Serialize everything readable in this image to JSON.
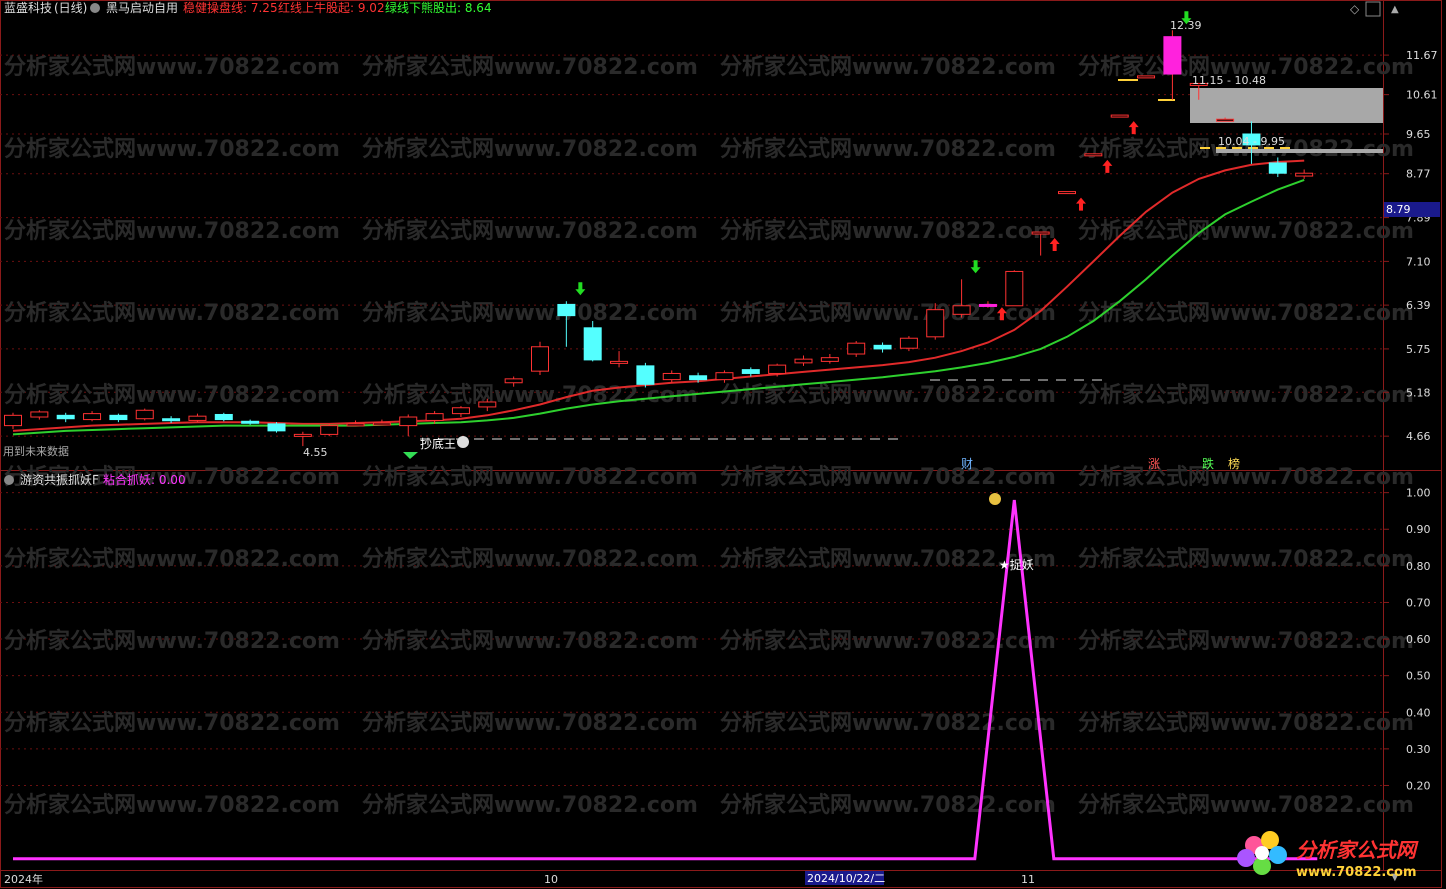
{
  "header": {
    "stock_name": "蓝盛科技",
    "period": "(日线)",
    "indicator_name": "黑马启动自用",
    "lines": [
      {
        "label": "稳健操盘线",
        "value": "7.25",
        "color": "#ff3333"
      },
      {
        "label": "红线上牛股起",
        "value": "9.02",
        "color": "#ff3333"
      },
      {
        "label": "绿线下熊股出",
        "value": "8.64",
        "color": "#33ff33"
      }
    ]
  },
  "window_controls": {
    "diamond_icon": "◇",
    "scroll_up_icon": "▲",
    "scroll_down_icon": "▼"
  },
  "watermark": "分析家公式网www.70822.com",
  "note_future_data": "用到未来数据",
  "markers": {
    "low_label": "4.55",
    "high_label": "12.39",
    "zone1_label": "11.15 - 10.48",
    "zone2_label": "10.04 - 9.95",
    "current_price": "8.79",
    "signal_text": "抄底王",
    "star_label": "★捉妖",
    "bottom_tags": [
      {
        "text": "财",
        "color": "#6fb4ff"
      },
      {
        "text": "涨",
        "color": "#ff5555"
      },
      {
        "text": "跌",
        "color": "#55ff55"
      },
      {
        "text": "榜",
        "color": "#ffdd55"
      }
    ]
  },
  "sub_header": {
    "indicator_name": "游资共振抓妖F",
    "line_label": "粘合抓妖",
    "line_value": "0.00",
    "line_color": "#ff33ff"
  },
  "x_axis": {
    "labels": [
      "2024年",
      "10",
      "11"
    ],
    "highlight_label": "2024/10/22/二"
  },
  "brand": {
    "name": "分析家公式网",
    "url": "www.70822.com"
  },
  "chart_data": [
    {
      "type": "candlestick",
      "y_ticks": [
        11.67,
        10.61,
        9.65,
        8.77,
        7.89,
        7.1,
        6.39,
        5.75,
        5.18,
        4.66
      ],
      "ylim": [
        4.4,
        12.7
      ],
      "scale": "log",
      "candles": [
        {
          "o": 4.78,
          "c": 4.9,
          "h": 4.93,
          "l": 4.74
        },
        {
          "o": 4.88,
          "c": 4.94,
          "h": 4.96,
          "l": 4.85
        },
        {
          "o": 4.9,
          "c": 4.86,
          "h": 4.93,
          "l": 4.82
        },
        {
          "o": 4.85,
          "c": 4.92,
          "h": 4.95,
          "l": 4.83
        },
        {
          "o": 4.9,
          "c": 4.85,
          "h": 4.92,
          "l": 4.82
        },
        {
          "o": 4.86,
          "c": 4.96,
          "h": 4.98,
          "l": 4.84
        },
        {
          "o": 4.86,
          "c": 4.84,
          "h": 4.89,
          "l": 4.81
        },
        {
          "o": 4.84,
          "c": 4.89,
          "h": 4.92,
          "l": 4.82
        },
        {
          "o": 4.91,
          "c": 4.85,
          "h": 4.93,
          "l": 4.83
        },
        {
          "o": 4.83,
          "c": 4.81,
          "h": 4.85,
          "l": 4.79
        },
        {
          "o": 4.8,
          "c": 4.72,
          "h": 4.82,
          "l": 4.7
        },
        {
          "o": 4.68,
          "c": 4.68,
          "h": 4.71,
          "l": 4.55
        },
        {
          "o": 4.68,
          "c": 4.78,
          "h": 4.8,
          "l": 4.66
        },
        {
          "o": 4.8,
          "c": 4.8,
          "h": 4.84,
          "l": 4.78
        },
        {
          "o": 4.81,
          "c": 4.81,
          "h": 4.85,
          "l": 4.79
        },
        {
          "o": 4.78,
          "c": 4.88,
          "h": 4.91,
          "l": 4.66
        },
        {
          "o": 4.84,
          "c": 4.92,
          "h": 4.95,
          "l": 4.8
        },
        {
          "o": 4.92,
          "c": 4.99,
          "h": 5.01,
          "l": 4.88
        },
        {
          "o": 5.0,
          "c": 5.06,
          "h": 5.1,
          "l": 4.95
        },
        {
          "o": 5.3,
          "c": 5.35,
          "h": 5.38,
          "l": 5.25
        },
        {
          "o": 5.45,
          "c": 5.78,
          "h": 5.85,
          "l": 5.4
        },
        {
          "o": 6.4,
          "c": 6.23,
          "h": 6.45,
          "l": 5.78
        },
        {
          "o": 6.05,
          "c": 5.6,
          "h": 6.15,
          "l": 5.58
        },
        {
          "o": 5.58,
          "c": 5.58,
          "h": 5.72,
          "l": 5.5
        },
        {
          "o": 5.52,
          "c": 5.28,
          "h": 5.56,
          "l": 5.24
        },
        {
          "o": 5.34,
          "c": 5.42,
          "h": 5.46,
          "l": 5.3
        },
        {
          "o": 5.39,
          "c": 5.34,
          "h": 5.43,
          "l": 5.3
        },
        {
          "o": 5.34,
          "c": 5.43,
          "h": 5.46,
          "l": 5.3
        },
        {
          "o": 5.47,
          "c": 5.42,
          "h": 5.5,
          "l": 5.38
        },
        {
          "o": 5.42,
          "c": 5.53,
          "h": 5.55,
          "l": 5.38
        },
        {
          "o": 5.56,
          "c": 5.61,
          "h": 5.66,
          "l": 5.52
        },
        {
          "o": 5.58,
          "c": 5.63,
          "h": 5.68,
          "l": 5.55
        },
        {
          "o": 5.68,
          "c": 5.83,
          "h": 5.86,
          "l": 5.64
        },
        {
          "o": 5.8,
          "c": 5.75,
          "h": 5.84,
          "l": 5.7
        },
        {
          "o": 5.76,
          "c": 5.9,
          "h": 5.93,
          "l": 5.72
        },
        {
          "o": 5.92,
          "c": 6.32,
          "h": 6.42,
          "l": 5.88
        },
        {
          "o": 6.25,
          "c": 6.38,
          "h": 6.8,
          "l": 6.2
        },
        {
          "o": 6.38,
          "c": 6.4,
          "h": 6.45,
          "l": 6.35
        },
        {
          "o": 6.38,
          "c": 6.93,
          "h": 6.95,
          "l": 6.38
        },
        {
          "o": 7.6,
          "c": 7.62,
          "h": 7.62,
          "l": 7.2
        },
        {
          "o": 8.4,
          "c": 8.4,
          "h": 8.4,
          "l": 8.4
        },
        {
          "o": 9.2,
          "c": 9.2,
          "h": 9.2,
          "l": 9.2
        },
        {
          "o": 10.1,
          "c": 10.1,
          "h": 10.1,
          "l": 10.1
        },
        {
          "o": 11.1,
          "c": 11.1,
          "h": 11.1,
          "l": 11.1
        },
        {
          "o": 11.15,
          "c": 12.2,
          "h": 12.39,
          "l": 10.48
        },
        {
          "o": 10.9,
          "c": 10.9,
          "h": 10.9,
          "l": 10.48
        },
        {
          "o": 10.0,
          "c": 10.0,
          "h": 10.04,
          "l": 9.95
        },
        {
          "o": 9.65,
          "c": 9.4,
          "h": 9.95,
          "l": 8.98
        },
        {
          "o": 9.0,
          "c": 8.78,
          "h": 9.12,
          "l": 8.7
        },
        {
          "o": 8.72,
          "c": 8.78,
          "h": 8.86,
          "l": 8.66
        }
      ],
      "series": [
        {
          "color": "#e02a2a",
          "values": [
            4.72,
            4.74,
            4.76,
            4.78,
            4.79,
            4.8,
            4.81,
            4.82,
            4.82,
            4.82,
            4.81,
            4.8,
            4.8,
            4.81,
            4.82,
            4.83,
            4.84,
            4.86,
            4.9,
            4.96,
            5.03,
            5.12,
            5.2,
            5.24,
            5.27,
            5.3,
            5.32,
            5.35,
            5.38,
            5.41,
            5.44,
            5.47,
            5.5,
            5.53,
            5.57,
            5.63,
            5.72,
            5.84,
            6.02,
            6.3,
            6.68,
            7.1,
            7.55,
            8.0,
            8.38,
            8.66,
            8.84,
            8.96,
            9.02,
            9.05
          ]
        },
        {
          "color": "#2ed02e",
          "values": [
            4.68,
            4.7,
            4.72,
            4.73,
            4.74,
            4.75,
            4.76,
            4.77,
            4.78,
            4.78,
            4.78,
            4.78,
            4.78,
            4.78,
            4.79,
            4.8,
            4.81,
            4.82,
            4.84,
            4.87,
            4.92,
            4.98,
            5.03,
            5.07,
            5.1,
            5.13,
            5.16,
            5.19,
            5.22,
            5.25,
            5.28,
            5.31,
            5.34,
            5.37,
            5.41,
            5.45,
            5.5,
            5.56,
            5.64,
            5.75,
            5.92,
            6.15,
            6.45,
            6.8,
            7.2,
            7.6,
            7.95,
            8.2,
            8.44,
            8.64
          ]
        }
      ]
    },
    {
      "type": "line",
      "y_ticks": [
        1.0,
        0.9,
        0.8,
        0.7,
        0.6,
        0.5,
        0.4,
        0.3,
        0.2
      ],
      "ylim": [
        -0.02,
        1.04
      ],
      "series": [
        {
          "color": "#ff33ff",
          "points": [
            [
              0,
              0
            ],
            [
              36.5,
              0
            ],
            [
              38,
              0.98
            ],
            [
              39.5,
              0
            ],
            [
              49.5,
              0
            ]
          ]
        }
      ]
    }
  ]
}
